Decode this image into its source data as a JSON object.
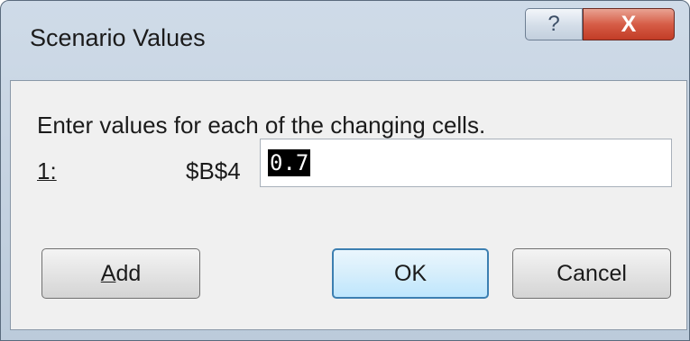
{
  "dialog": {
    "title": "Scenario Values",
    "help_label": "?",
    "close_label": "X"
  },
  "content": {
    "prompt": "Enter values for each of the changing cells.",
    "rows": [
      {
        "index": "1:",
        "cell": "$B$4",
        "value": "0.7"
      }
    ]
  },
  "buttons": {
    "add": "Add",
    "ok": "OK",
    "cancel": "Cancel"
  }
}
